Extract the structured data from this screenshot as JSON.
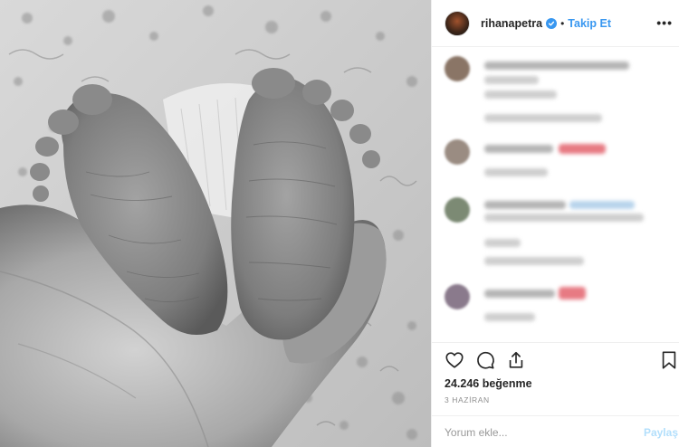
{
  "post": {
    "username": "rihanapetra",
    "follow_label": "Takip Et",
    "separator": "•",
    "more_label": "•••",
    "likes_text": "24.246 beğenme",
    "date_text": "3 HAZİRAN",
    "comment_placeholder": "Yorum ekle...",
    "post_label": "Paylaş"
  },
  "icons": {
    "like": "heart-icon",
    "comment": "comment-icon",
    "share": "share-icon",
    "save": "bookmark-icon",
    "verified": "verified-badge-icon"
  },
  "colors": {
    "accent": "#3897f0",
    "text": "#262626",
    "muted": "#8e8e8e",
    "post_disabled": "#b2dffc"
  }
}
